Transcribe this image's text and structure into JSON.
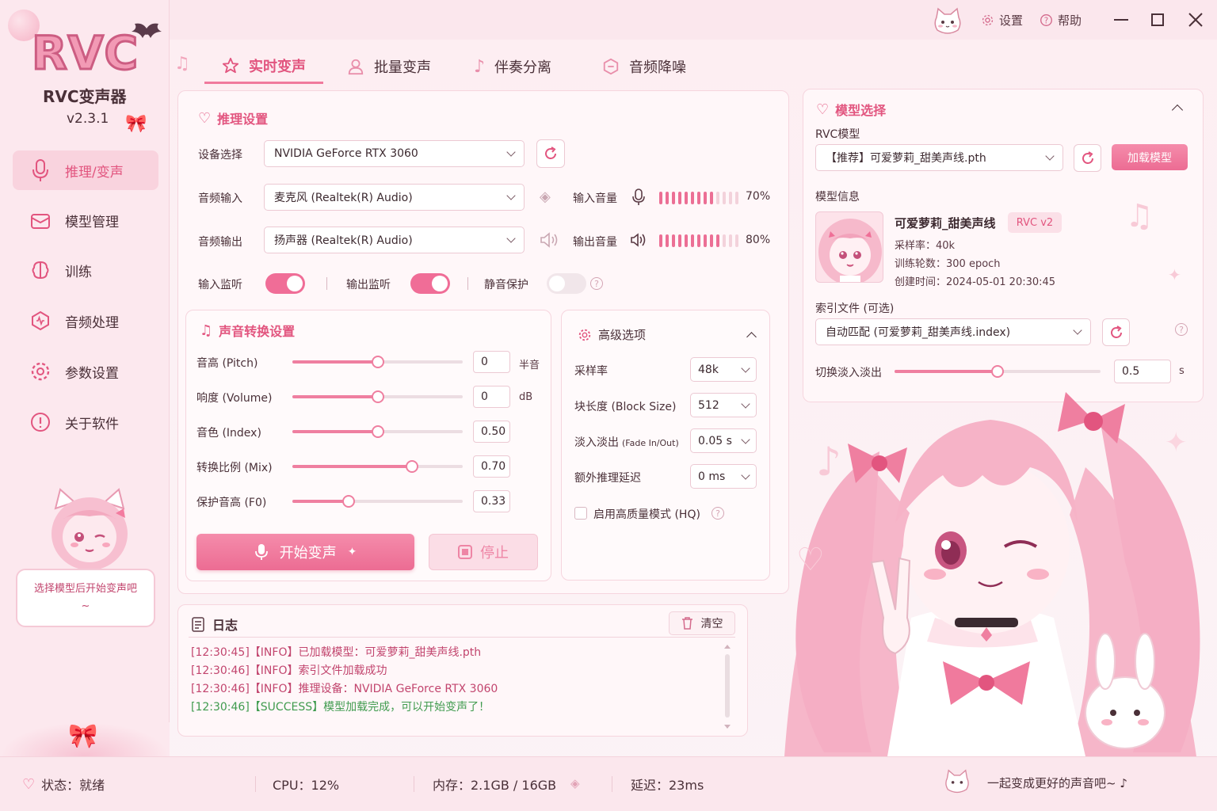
{
  "app": {
    "logo_text": "RVC",
    "name": "RVC变声器",
    "version": "v2.3.1"
  },
  "titlebar": {
    "settings_label": "设置",
    "help_label": "帮助"
  },
  "sidebar": {
    "items": [
      {
        "label": "推理/变声",
        "icon": "microphone-icon",
        "active": true
      },
      {
        "label": "模型管理",
        "icon": "box-icon"
      },
      {
        "label": "训练",
        "icon": "brain-icon"
      },
      {
        "label": "音频处理",
        "icon": "waveform-icon"
      },
      {
        "label": "参数设置",
        "icon": "gear-icon"
      },
      {
        "label": "关于软件",
        "icon": "info-icon"
      }
    ],
    "hint": "选择模型后开始变声吧~"
  },
  "tabs": [
    {
      "label": "实时变声",
      "icon": "star-icon",
      "active": true
    },
    {
      "label": "批量变声",
      "icon": "user-icon"
    },
    {
      "label": "伴奏分离",
      "icon": "music-note-icon"
    },
    {
      "label": "音频降噪",
      "icon": "noise-icon"
    }
  ],
  "inference": {
    "title": "推理设置",
    "device_label": "设备选择",
    "device_value": "NVIDIA GeForce RTX 3060",
    "input_label": "音频输入",
    "input_value": "麦克风 (Realtek(R) Audio)",
    "output_label": "音频输出",
    "output_value": "扬声器 (Realtek(R) Audio)",
    "input_volume_label": "输入音量",
    "input_volume": "70%",
    "input_volume_level": 0.7,
    "output_volume_label": "输出音量",
    "output_volume": "80%",
    "output_volume_level": 0.8,
    "input_monitor_label": "输入监听",
    "input_monitor": true,
    "output_monitor_label": "输出监听",
    "output_monitor": true,
    "mute_protect_label": "静音保护",
    "mute_protect": false
  },
  "voice": {
    "title": "声音转换设置",
    "params": [
      {
        "label": "音高 (Pitch)",
        "value": "0",
        "unit": "半音",
        "level": 0.5
      },
      {
        "label": "响度 (Volume)",
        "value": "0",
        "unit": "dB",
        "level": 0.5
      },
      {
        "label": "音色 (Index)",
        "value": "0.50",
        "unit": "",
        "level": 0.5
      },
      {
        "label": "转换比例 (Mix)",
        "value": "0.70",
        "unit": "",
        "level": 0.7
      },
      {
        "label": "保护音高 (F0)",
        "value": "0.33",
        "unit": "",
        "level": 0.33
      }
    ],
    "start_label": "开始变声",
    "stop_label": "停止"
  },
  "advanced": {
    "title": "高级选项",
    "items": [
      {
        "label": "采样率",
        "value": "48k"
      },
      {
        "label": "块长度 (Block Size)",
        "value": "512"
      },
      {
        "label": "淡入淡出",
        "label_small": "(Fade In/Out)",
        "value": "0.05 s"
      },
      {
        "label": "额外推理延迟",
        "value": "0 ms"
      }
    ],
    "hq_label": "启用高质量模式 (HQ)"
  },
  "model": {
    "title": "模型选择",
    "rvc_label": "RVC模型",
    "model_value": "【推荐】可爱萝莉_甜美声线.pth",
    "load_label": "加载模型",
    "info_label": "模型信息",
    "name": "可爱萝莉_甜美声线",
    "badge": "RVC v2",
    "sample_rate": "采样率：40k",
    "epochs": "训练轮数：300 epoch",
    "created": "创建时间：2024-05-01 20:30:45",
    "index_label": "索引文件 (可选)",
    "index_value": "自动匹配 (可爱萝莉_甜美声线.index)",
    "crossfade_label": "切换淡入淡出",
    "crossfade_value": "0.5",
    "crossfade_unit": "s",
    "crossfade_level": 0.5
  },
  "log": {
    "title": "日志",
    "clear_label": "清空",
    "lines": [
      {
        "text": "[12:30:45]【INFO】已加载模型：可爱萝莉_甜美声线.pth",
        "color": "#c2456e"
      },
      {
        "text": "[12:30:46]【INFO】索引文件加载成功",
        "color": "#c2456e"
      },
      {
        "text": "[12:30:46]【INFO】推理设备：NVIDIA GeForce RTX 3060",
        "color": "#c2456e"
      },
      {
        "text": "[12:30:46]【SUCCESS】模型加载完成，可以开始变声了！",
        "color": "#3f9b4e"
      }
    ]
  },
  "status": {
    "state": "状态：就绪",
    "cpu": "CPU：12%",
    "memory": "内存：2.1GB / 16GB",
    "latency": "延迟：23ms",
    "slogan": "一起变成更好的声音吧~ ♪"
  },
  "colors": {
    "accent": "#ef6f97",
    "bg": "#fdf1f4",
    "panel": "#fff7f9"
  }
}
